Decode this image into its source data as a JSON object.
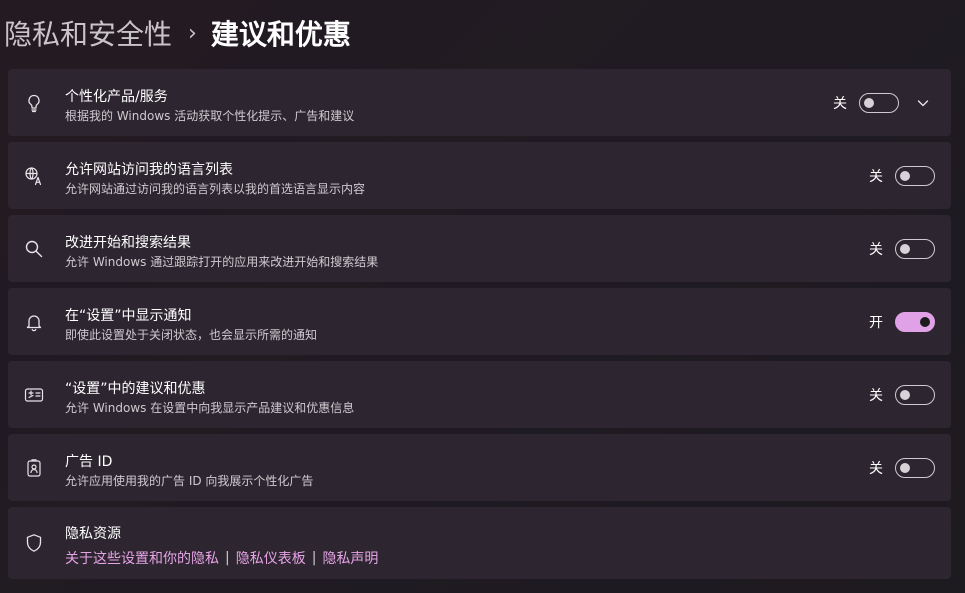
{
  "breadcrumb": {
    "parent": "隐私和安全性",
    "separator": "›",
    "current": "建议和优惠"
  },
  "settings": [
    {
      "title": "个性化产品/服务",
      "desc": "根据我的 Windows 活动获取个性化提示、广告和建议",
      "state": "关",
      "on": false,
      "icon": "lightbulb-icon",
      "expand": true
    },
    {
      "title": "允许网站访问我的语言列表",
      "desc": "允许网站通过访问我的语言列表以我的首选语言显示内容",
      "state": "关",
      "on": false,
      "icon": "language-icon"
    },
    {
      "title": "改进开始和搜索结果",
      "desc": "允许 Windows 通过跟踪打开的应用来改进开始和搜索结果",
      "state": "关",
      "on": false,
      "icon": "search-icon"
    },
    {
      "title": "在“设置”中显示通知",
      "desc": "即使此设置处于关闭状态，也会显示所需的通知",
      "state": "开",
      "on": true,
      "icon": "bell-icon"
    },
    {
      "title": "“设置”中的建议和优惠",
      "desc": "允许 Windows 在设置中向我显示产品建议和优惠信息",
      "state": "关",
      "on": false,
      "icon": "offer-card-icon"
    },
    {
      "title": "广告 ID",
      "desc": "允许应用使用我的广告 ID 向我展示个性化广告",
      "state": "关",
      "on": false,
      "icon": "id-badge-icon"
    }
  ],
  "privacy_resources": {
    "title": "隐私资源",
    "icon": "shield-icon",
    "links": [
      "关于这些设置和你的隐私",
      "隐私仪表板",
      "隐私声明"
    ],
    "separator": "|"
  }
}
